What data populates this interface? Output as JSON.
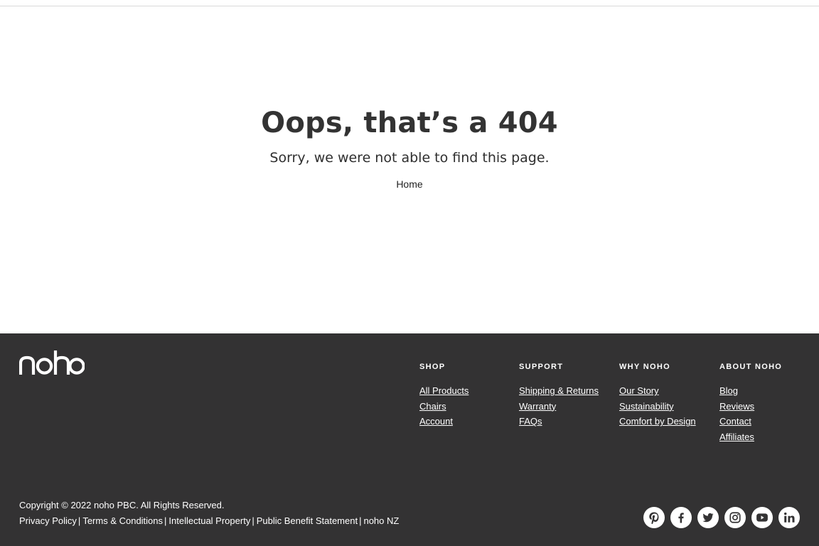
{
  "error": {
    "title": "Oops, that’s a 404",
    "subtitle": "Sorry, we were not able to find this page.",
    "home_link": "Home"
  },
  "footer": {
    "logo_text": "noho",
    "columns": [
      {
        "heading": "SHOP",
        "links": [
          "All Products",
          "Chairs",
          "Account"
        ]
      },
      {
        "heading": "SUPPORT",
        "links": [
          "Shipping & Returns",
          "Warranty",
          "FAQs"
        ]
      },
      {
        "heading": "WHY NOHO",
        "links": [
          "Our Story",
          "Sustainability",
          "Comfort by Design"
        ]
      },
      {
        "heading": "ABOUT NOHO",
        "links": [
          "Blog",
          "Reviews",
          "Contact",
          "Affiliates"
        ]
      }
    ],
    "copyright": "Copyright © 2022 noho PBC. All Rights Reserved.",
    "legal_links": [
      "Privacy Policy",
      "Terms & Conditions",
      "Intellectual Property",
      "Public Benefit Statement",
      "noho NZ"
    ],
    "legal_separator": "|",
    "social_icons": [
      "pinterest-icon",
      "facebook-icon",
      "twitter-icon",
      "instagram-icon",
      "youtube-icon",
      "linkedin-icon"
    ]
  },
  "colors": {
    "footer_bg": "#333233",
    "text_dark": "#333333",
    "white": "#ffffff"
  }
}
